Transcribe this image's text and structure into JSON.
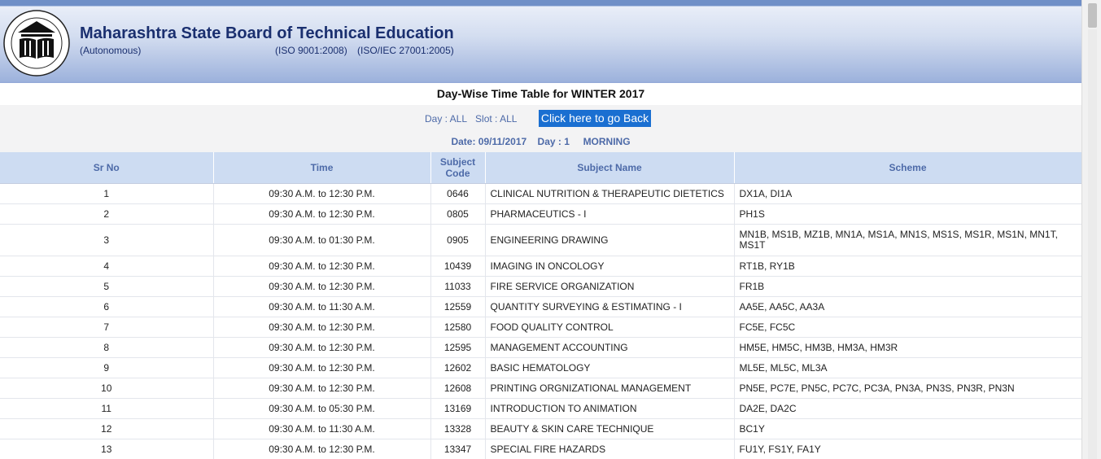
{
  "header": {
    "title": "Maharashtra State Board of Technical Education",
    "autonomous": "(Autonomous)",
    "iso1": "(ISO 9001:2008)",
    "iso2": "(ISO/IEC 27001:2005)"
  },
  "page_title": "Day-Wise Time Table for WINTER 2017",
  "filter": {
    "day_label": "Day : ALL",
    "slot_label": "Slot : ALL",
    "back_button": "Click here to go Back"
  },
  "date_bar": {
    "date": "Date: 09/11/2017",
    "day": "Day : 1",
    "session": "MORNING"
  },
  "table": {
    "headers": [
      "Sr No",
      "Time",
      "Subject Code",
      "Subject Name",
      "Scheme"
    ],
    "rows": [
      {
        "sr": "1",
        "time": "09:30 A.M. to 12:30 P.M.",
        "code": "0646",
        "name": "CLINICAL NUTRITION & THERAPEUTIC DIETETICS",
        "scheme": "DX1A, DI1A"
      },
      {
        "sr": "2",
        "time": "09:30 A.M. to 12:30 P.M.",
        "code": "0805",
        "name": "PHARMACEUTICS - I",
        "scheme": "PH1S"
      },
      {
        "sr": "3",
        "time": "09:30 A.M. to 01:30 P.M.",
        "code": "0905",
        "name": "ENGINEERING DRAWING",
        "scheme": "MN1B, MS1B, MZ1B, MN1A, MS1A, MN1S, MS1S, MS1R, MS1N, MN1T, MS1T"
      },
      {
        "sr": "4",
        "time": "09:30 A.M. to 12:30 P.M.",
        "code": "10439",
        "name": "IMAGING IN ONCOLOGY",
        "scheme": "RT1B, RY1B"
      },
      {
        "sr": "5",
        "time": "09:30 A.M. to 12:30 P.M.",
        "code": "11033",
        "name": "FIRE SERVICE ORGANIZATION",
        "scheme": "FR1B"
      },
      {
        "sr": "6",
        "time": "09:30 A.M. to 11:30 A.M.",
        "code": "12559",
        "name": "QUANTITY SURVEYING & ESTIMATING - I",
        "scheme": "AA5E, AA5C, AA3A"
      },
      {
        "sr": "7",
        "time": "09:30 A.M. to 12:30 P.M.",
        "code": "12580",
        "name": "FOOD QUALITY CONTROL",
        "scheme": "FC5E, FC5C"
      },
      {
        "sr": "8",
        "time": "09:30 A.M. to 12:30 P.M.",
        "code": "12595",
        "name": "MANAGEMENT ACCOUNTING",
        "scheme": "HM5E, HM5C, HM3B, HM3A, HM3R"
      },
      {
        "sr": "9",
        "time": "09:30 A.M. to 12:30 P.M.",
        "code": "12602",
        "name": "BASIC HEMATOLOGY",
        "scheme": "ML5E, ML5C, ML3A"
      },
      {
        "sr": "10",
        "time": "09:30 A.M. to 12:30 P.M.",
        "code": "12608",
        "name": "PRINTING ORGNIZATIONAL MANAGEMENT",
        "scheme": "PN5E, PC7E, PN5C, PC7C, PC3A, PN3A, PN3S, PN3R, PN3N"
      },
      {
        "sr": "11",
        "time": "09:30 A.M. to 05:30 P.M.",
        "code": "13169",
        "name": "INTRODUCTION TO ANIMATION",
        "scheme": "DA2E, DA2C"
      },
      {
        "sr": "12",
        "time": "09:30 A.M. to 11:30 A.M.",
        "code": "13328",
        "name": "BEAUTY & SKIN CARE TECHNIQUE",
        "scheme": "BC1Y"
      },
      {
        "sr": "13",
        "time": "09:30 A.M. to 12:30 P.M.",
        "code": "13347",
        "name": "SPECIAL FIRE HAZARDS",
        "scheme": "FU1Y, FS1Y, FA1Y"
      }
    ]
  }
}
